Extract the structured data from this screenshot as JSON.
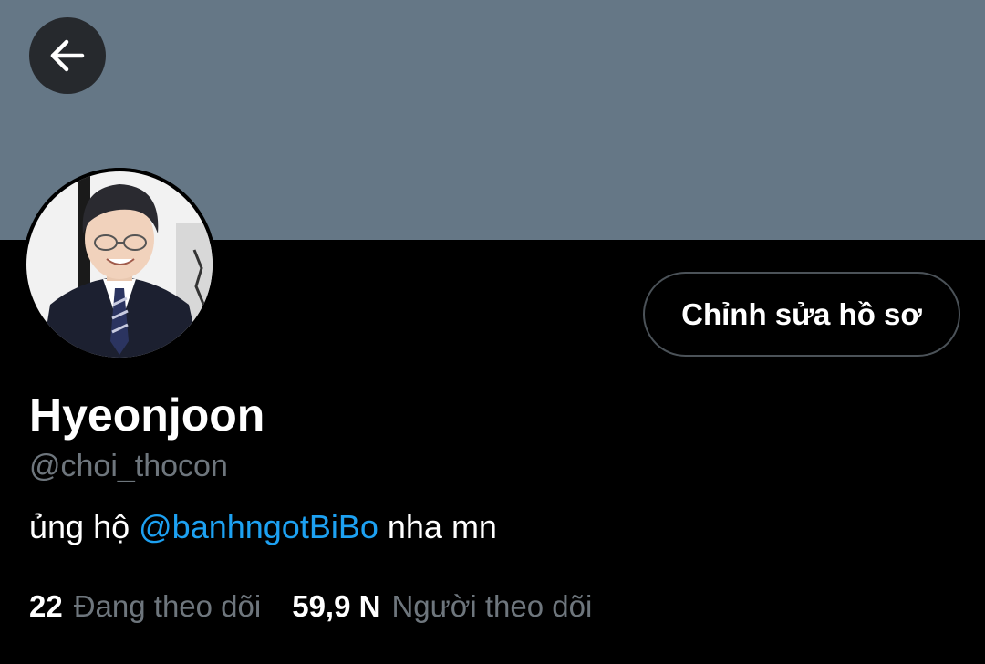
{
  "colors": {
    "banner": "#657786",
    "background": "#000000",
    "accent": "#1da1f2",
    "muted_text": "#6e767d"
  },
  "header": {
    "back_icon": "arrow-left-icon"
  },
  "profile": {
    "avatar_icon": "profile-photo",
    "edit_button_label": "Chỉnh sửa hồ sơ",
    "display_name": "Hyeonjoon",
    "handle": "@choi_thocon",
    "bio": {
      "prefix": "ủng hộ ",
      "mention": "@banhngotBiBo",
      "suffix": " nha mn"
    },
    "stats": {
      "following_count": "22",
      "following_label": "Đang theo dõi",
      "followers_count": "59,9 N",
      "followers_label": "Người theo dõi"
    }
  }
}
